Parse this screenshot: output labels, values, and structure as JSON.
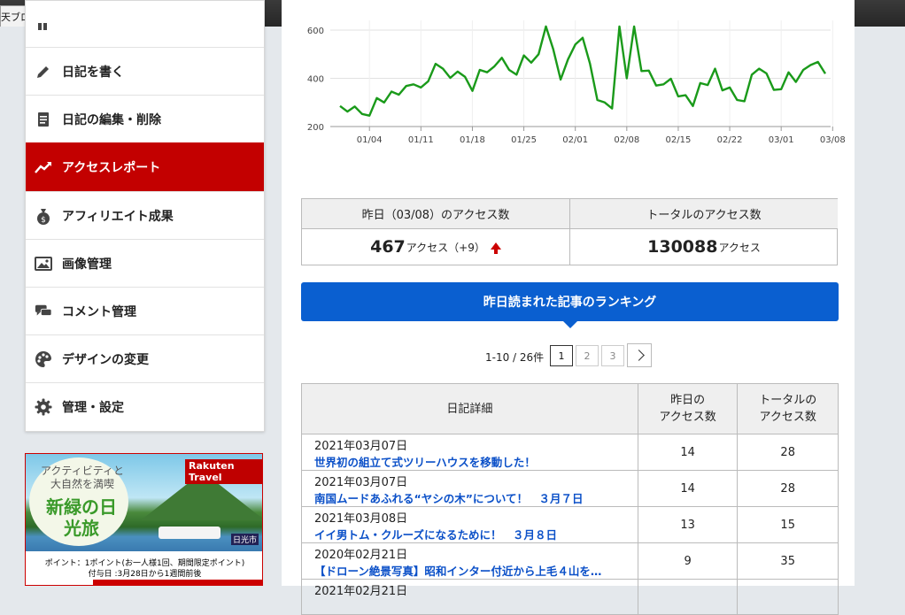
{
  "browser": {
    "tab_title": "天ブログ",
    "close_glyph": "×"
  },
  "sidebar": {
    "items": [
      {
        "label": "日記を書く",
        "icon": "pencil-icon"
      },
      {
        "label": "日記の編集・削除",
        "icon": "document-icon"
      },
      {
        "label": "アクセスレポート",
        "icon": "trend-icon",
        "active": true
      },
      {
        "label": "アフィリエイト成果",
        "icon": "money-bag-icon"
      },
      {
        "label": "画像管理",
        "icon": "image-icon"
      },
      {
        "label": "コメント管理",
        "icon": "comment-icon"
      },
      {
        "label": "デザインの変更",
        "icon": "palette-icon"
      },
      {
        "label": "管理・設定",
        "icon": "gear-icon"
      }
    ],
    "active_color": "#c30000"
  },
  "ad": {
    "headline_small": "アクティビティと大自然を満喫",
    "headline_big": "新緑の日光旅",
    "brand": "Rakuten Travel",
    "place": "日光市",
    "line1": "ポイント：1ポイント(お一人様1回、期間限定ポイント)",
    "line2": "付与日 :3月28日から1週間前後"
  },
  "chart_data": {
    "type": "line",
    "ylim": [
      200,
      640
    ],
    "yticks": [
      200,
      400,
      600
    ],
    "xticks": [
      "01/04",
      "01/11",
      "01/18",
      "01/25",
      "02/01",
      "02/08",
      "02/15",
      "02/22",
      "03/01",
      "03/08"
    ],
    "grid": true,
    "color": "#1a9a1a",
    "series": [
      {
        "x_start": "12/31",
        "values": [
          285,
          262,
          283,
          252,
          245,
          318,
          300,
          345,
          332,
          368,
          375,
          362,
          388,
          460,
          440,
          402,
          428,
          406,
          348,
          435,
          425,
          450,
          485,
          435,
          415,
          495,
          465,
          500,
          615,
          520,
          395,
          478,
          540,
          568,
          460,
          310,
          300,
          275,
          615,
          400,
          615,
          430,
          432,
          370,
          375,
          398,
          325,
          330,
          285,
          380,
          372,
          440,
          350,
          362,
          310,
          305,
          415,
          440,
          420,
          352,
          355,
          425,
          385,
          435,
          455,
          468,
          419
        ]
      }
    ]
  },
  "summary": {
    "yesterday_header": "昨日（03/08）のアクセス数",
    "total_header": "トータルのアクセス数",
    "yesterday_value": "467",
    "yesterday_unit": "アクセス（+9）",
    "total_value": "130088",
    "total_unit": "アクセス"
  },
  "ranking": {
    "title": "昨日読まれた記事のランキング",
    "pager_info": "1-10 / 26件",
    "pages": [
      "1",
      "2",
      "3"
    ],
    "current_page": "1",
    "headers": {
      "detail": "日記詳細",
      "yesterday_line1": "昨日の",
      "yesterday_line2": "アクセス数",
      "total_line1": "トータルの",
      "total_line2": "アクセス数"
    },
    "rows": [
      {
        "date": "2021年03月07日",
        "title": "世界初の組立て式ツリーハウスを移動した！",
        "yesterday": "14",
        "total": "28"
      },
      {
        "date": "2021年03月07日",
        "title": "南国ムードあふれる“ヤシの木”について！　３月７日",
        "yesterday": "14",
        "total": "28"
      },
      {
        "date": "2021年03月08日",
        "title": "イイ男トム・クルーズになるために！　３月８日",
        "yesterday": "13",
        "total": "15"
      },
      {
        "date": "2020年02月21日",
        "title": "【ドローン絶景写真】昭和インター付近から上毛４山を…",
        "yesterday": "9",
        "total": "35"
      },
      {
        "date": "2021年02月21日",
        "title": "",
        "yesterday": "",
        "total": ""
      }
    ]
  }
}
